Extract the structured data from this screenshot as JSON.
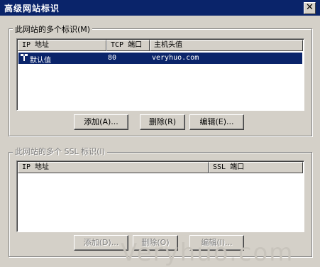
{
  "window": {
    "title": "高级网站标识",
    "close_glyph": "✕"
  },
  "group1": {
    "legend": "此网站的多个标识(M)",
    "columns": [
      "IP 地址",
      "TCP 端口",
      "主机头值"
    ],
    "rows": [
      {
        "ip": "默认值",
        "port": "80",
        "host": "veryhuo.com",
        "selected": true
      }
    ],
    "buttons": {
      "add": "添加(A)...",
      "remove": "删除(R)",
      "edit": "编辑(E)..."
    }
  },
  "group2": {
    "legend": "此网站的多个 SSL 标识(I)",
    "columns": [
      "IP 地址",
      "SSL 端口"
    ],
    "buttons": {
      "add": "添加(D)...",
      "remove": "删除(O)",
      "edit": "编辑(I)..."
    }
  },
  "watermark": "Veryhuo.com"
}
